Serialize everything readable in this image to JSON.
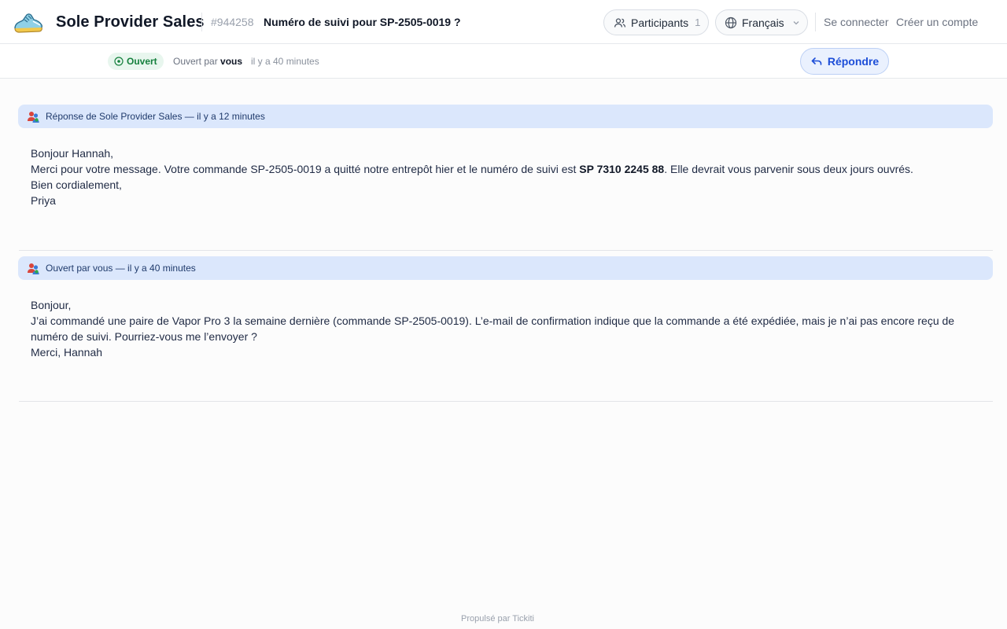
{
  "header": {
    "brand": "Sole Provider Sales",
    "ticket_id": "#944258",
    "ticket_title": "Numéro de suivi pour SP-2505-0019 ?",
    "participants_label": "Participants",
    "participants_count": "1",
    "language_label": "Français",
    "login_label": "Se connecter",
    "signup_label": "Créer un compte"
  },
  "subbar": {
    "status": "Ouvert",
    "opened_by_prefix": "Ouvert par",
    "opened_by_user": "vous",
    "opened_ago": "il y a 40 minutes",
    "reply_label": "Répondre"
  },
  "messages": [
    {
      "header": "Réponse de Sole Provider Sales — il y a 12 minutes",
      "lines": [
        "Bonjour Hannah,",
        "Merci pour votre message. Votre commande SP-2505-0019 a quitté notre entrepôt hier et le numéro de suivi est ",
        "SP 7310 2245 88",
        ". Elle devrait vous parvenir sous deux jours ouvrés.",
        "Bien cordialement,",
        "Priya"
      ]
    },
    {
      "header": "Ouvert par vous — il y a 40 minutes",
      "lines": [
        "Bonjour,",
        "J’ai commandé une paire de Vapor Pro 3 la semaine dernière (commande SP-2505-0019). L’e-mail de confirmation indique que la commande a été expédiée, mais je n’ai pas encore reçu de numéro de suivi. Pourriez-vous me l’envoyer ?",
        "Merci, Hannah"
      ]
    }
  ],
  "footer": "Propulsé par Tickiti",
  "colors": {
    "accent": "#1d4ed8",
    "status_green": "#15803d",
    "message_header_bg": "#dbe7fc"
  }
}
